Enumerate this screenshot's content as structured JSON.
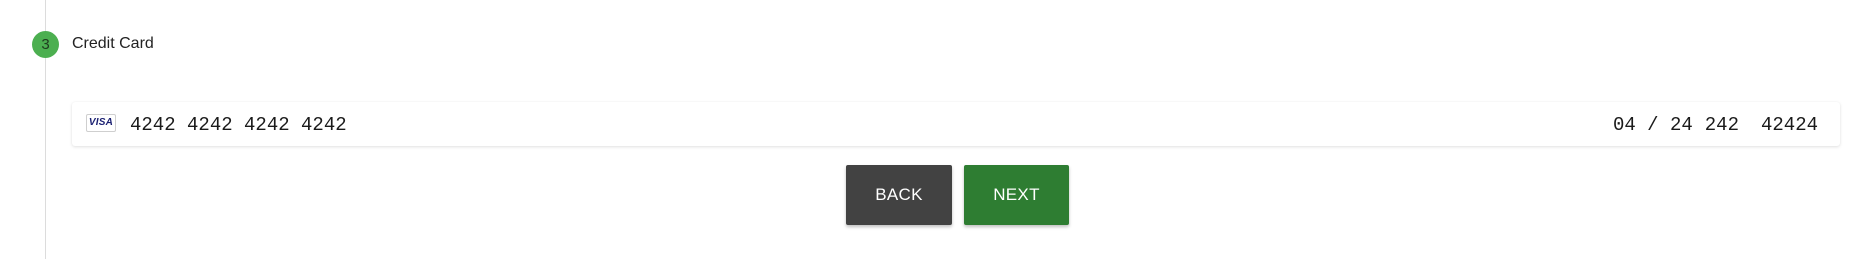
{
  "step": {
    "number": "3",
    "title": "Credit Card"
  },
  "card": {
    "brand_label": "VISA",
    "brand_icon": "visa-card-icon",
    "number": "4242 4242 4242 4242",
    "expiry": "04 / 24",
    "cvc": "242",
    "zip": "42424"
  },
  "actions": {
    "back_label": "BACK",
    "next_label": "NEXT"
  },
  "colors": {
    "step_circle": "#4caf50",
    "back_button": "#424242",
    "next_button": "#2e7d32"
  }
}
